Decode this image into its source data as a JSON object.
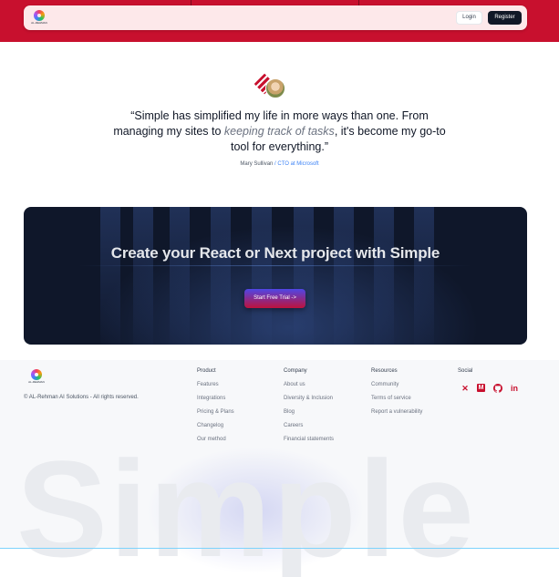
{
  "nav": {
    "logo_text": "AL-REHMAN",
    "login_label": "Login",
    "register_label": "Register"
  },
  "testimonial": {
    "quote_part1": "“Simple has simplified my life in more ways than one. From managing my sites to ",
    "quote_emphasis": "keeping track of tasks",
    "quote_part2": ", it's become my go-to tool for everything.”",
    "author": "Mary Sullivan",
    "separator": " / ",
    "role": "CTO at Microsoft"
  },
  "cta": {
    "heading": "Create your React or Next project with Simple",
    "button_label": "Start Free Trial ->"
  },
  "footer": {
    "logo_text": "AL-REHMAN",
    "copyright": "© AL-Rehman AI Solutions - All rights reserved.",
    "columns": [
      {
        "heading": "Product",
        "links": [
          "Features",
          "Integrations",
          "Pricing & Plans",
          "Changelog",
          "Our method"
        ]
      },
      {
        "heading": "Company",
        "links": [
          "About us",
          "Diversity & Inclusion",
          "Blog",
          "Careers",
          "Financial statements"
        ]
      },
      {
        "heading": "Resources",
        "links": [
          "Community",
          "Terms of service",
          "Report a vulnerability"
        ]
      }
    ],
    "social": {
      "heading": "Social",
      "icons": [
        "x-icon",
        "medium-icon",
        "github-icon",
        "linkedin-icon"
      ]
    },
    "watermark": "Simple"
  },
  "colors": {
    "brand_red": "#c8102e",
    "dark": "#0f172a",
    "link_blue": "#3b82f6"
  }
}
